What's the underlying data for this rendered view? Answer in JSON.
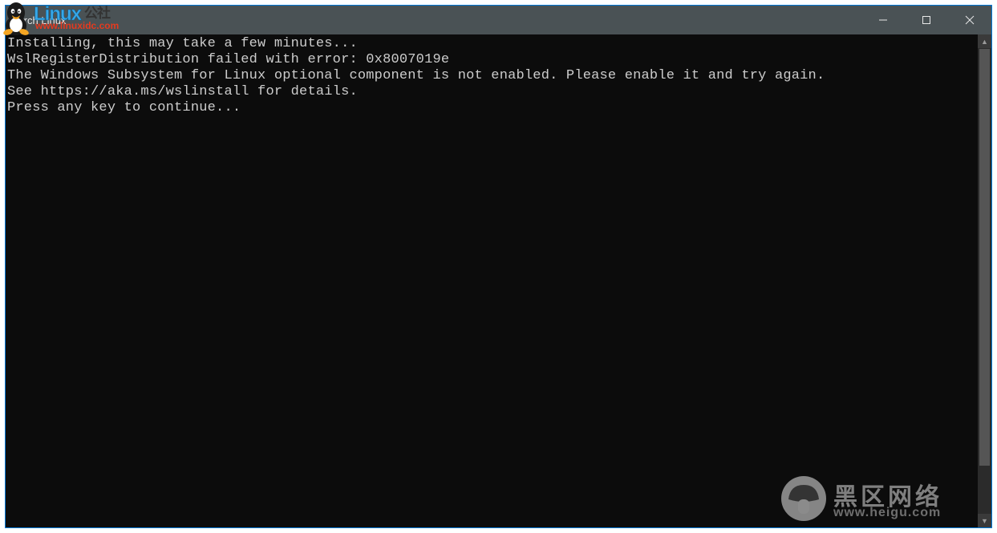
{
  "window": {
    "title": "Arch Linux"
  },
  "terminal": {
    "lines": [
      "Installing, this may take a few minutes...",
      "WslRegisterDistribution failed with error: 0x8007019e",
      "The Windows Subsystem for Linux optional component is not enabled. Please enable it and try again.",
      "See https://aka.ms/wslinstall for details.",
      "Press any key to continue..."
    ]
  },
  "watermark_top_left": {
    "brand": "Linux",
    "brand_cn": "公社",
    "url": "www.linuxidc.com"
  },
  "watermark_bottom_right": {
    "name": "黑区网络",
    "url": "www.heigu.com"
  }
}
